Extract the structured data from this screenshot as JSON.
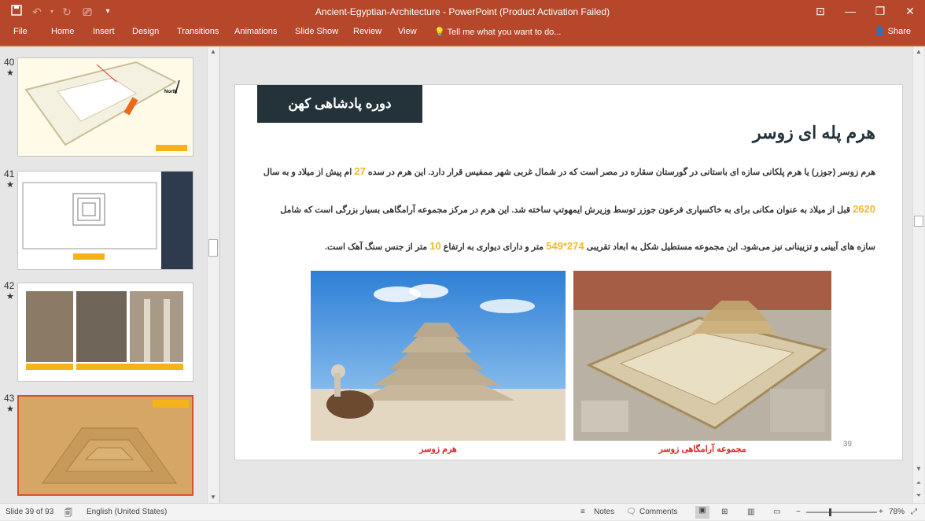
{
  "app": {
    "title": "Ancient-Egyptian-Architecture - PowerPoint (Product Activation Failed)",
    "share": "Share",
    "tell": "Tell me what you want to do..."
  },
  "ribbon_tabs": [
    "File",
    "Home",
    "Insert",
    "Design",
    "Transitions",
    "Animations",
    "Slide Show",
    "Review",
    "View"
  ],
  "thumbnails": [
    {
      "number": "40",
      "star": "★",
      "north_label": "North"
    },
    {
      "number": "41",
      "star": "★"
    },
    {
      "number": "42",
      "star": "★"
    },
    {
      "number": "43",
      "star": "★"
    }
  ],
  "slide": {
    "banner": "دوره پادشاهی کهن",
    "title": "هرم پله ای زوسر",
    "para1_a": "هرم زوسر (جوزر) یا هرم پلکانی سازه ای باستانی در گورستان سقاره در مصر است که در شمال غربی شهر ممفیس قرار دارد. این هرم در سده ",
    "para1_num": "27",
    "para1_b": " ام پیش از میلاد و به سال",
    "para2_num": "2620",
    "para2_b": " قبل از میلاد به عنوان مکانی برای به خاکسپاری فرعون جوزر توسط وزیرش ایمهوتپ ساخته شد. این هرم در مرکز مجموعه آرامگاهی بسیار بزرگی است که شامل",
    "para3_a": "سازه های آیینی و تزیینانی نیز می‌شود. این مجموعه مستطیل شکل به ابعاد تقریبی ",
    "para3_num1": "274*549",
    "para3_b": " متر و دارای دیواری به ارتفاع ",
    "para3_num2": "10",
    "para3_c": " متر از جنس سنگ آهک است.",
    "caption_left": "هرم زوسر",
    "caption_right": "مجموعه آرامگاهی زوسر",
    "page_number": "39"
  },
  "status": {
    "slide_info": "Slide 39 of 93",
    "language": "English (United States)",
    "notes": "Notes",
    "comments": "Comments",
    "zoom": "78%"
  }
}
